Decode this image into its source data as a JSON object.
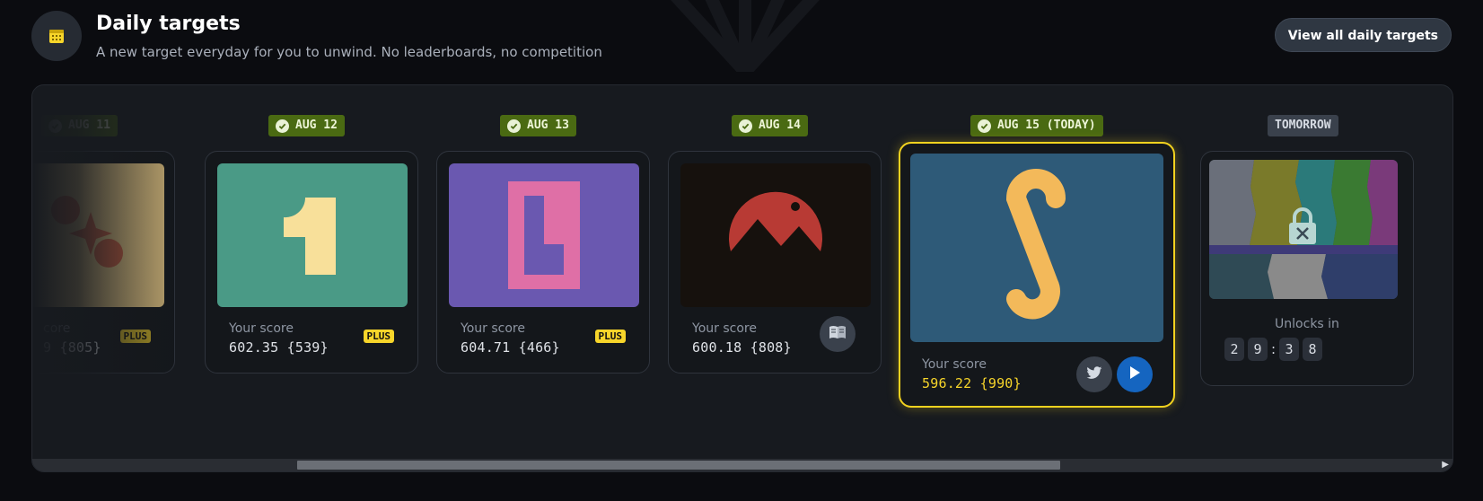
{
  "header": {
    "title": "Daily targets",
    "subtitle": "A new target everyday for you to unwind. No leaderboards, no competition",
    "view_all_label": "View all daily targets"
  },
  "cards": [
    {
      "date": "AUG 11",
      "score_label": "core",
      "score": "9 {805}",
      "plus": "PLUS",
      "thumb": "beige-sparkle",
      "completed": true
    },
    {
      "date": "AUG 12",
      "score_label": "Your score",
      "score": "602.35 {539}",
      "plus": "PLUS",
      "thumb": "number-one",
      "completed": true
    },
    {
      "date": "AUG 13",
      "score_label": "Your score",
      "score": "604.71 {466}",
      "plus": "PLUS",
      "thumb": "letter-l",
      "completed": true
    },
    {
      "date": "AUG 14",
      "score_label": "Your score",
      "score": "600.18 {808}",
      "thumb": "red-mountain",
      "completed": true,
      "action_icon": "book-icon"
    },
    {
      "date": "AUG 15 (TODAY)",
      "score_label": "Your score",
      "score": "596.22 {990}",
      "thumb": "letter-s",
      "completed": true,
      "action_icons": [
        "twitter-icon",
        "play-icon"
      ]
    }
  ],
  "tomorrow": {
    "badge": "TOMORROW",
    "unlock_label": "Unlocks in",
    "countdown": [
      "2",
      "9",
      "3",
      "8"
    ],
    "thumb": "glitch-locked"
  },
  "colors": {
    "accent_yellow": "#f7d52a",
    "badge_green": "#4a6a12",
    "play_blue": "#1565c0"
  }
}
